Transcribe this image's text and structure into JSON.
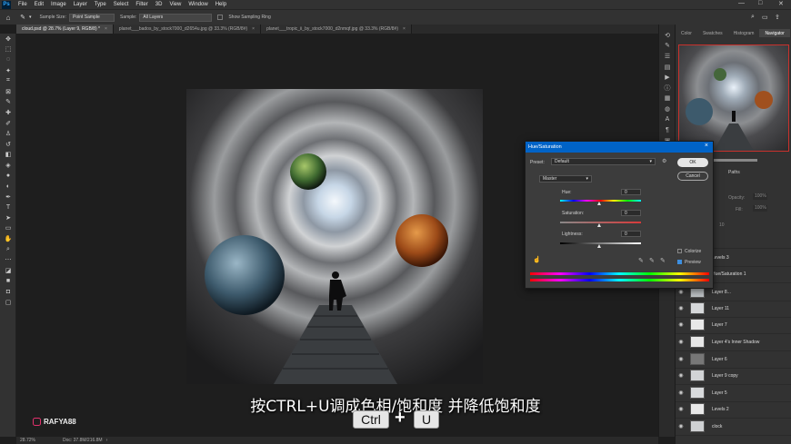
{
  "menubar": {
    "logo": "Ps",
    "items": [
      "File",
      "Edit",
      "Image",
      "Layer",
      "Type",
      "Select",
      "Filter",
      "3D",
      "View",
      "Window",
      "Help"
    ],
    "minimize": "—",
    "maximize": "□",
    "close": "✕"
  },
  "options": {
    "sample_size_label": "Sample Size:",
    "sample_size_value": "Point Sample",
    "sample_label": "Sample:",
    "sample_value": "All Layers",
    "show_ring_label": "Show Sampling Ring"
  },
  "tabs": [
    {
      "label": "cloud.psd @ 28.7% (Layer 9, RGB/8) *",
      "active": true
    },
    {
      "label": "planet___bados_by_stock7000_d2654u.jpg @ 33.3% (RGB/8#)",
      "active": false
    },
    {
      "label": "planet___tropic_ii_by_stock7000_d2nmqf.jpg @ 33.3% (RGB/8#)",
      "active": false
    }
  ],
  "status": {
    "zoom": "28.72%",
    "doc": "Doc: 37.8M/216.8M"
  },
  "panel": {
    "tabs": [
      "Color",
      "Swatches",
      "Histogram",
      "Navigator"
    ],
    "active_tab": "Navigator",
    "paths_label": "Paths",
    "opacity_label": "Opacity:",
    "opacity_value": "100%",
    "fill_label": "Fill:",
    "fill_value": "100%",
    "layer_group_label": "10"
  },
  "layers": [
    {
      "name": "",
      "thumb": "light"
    },
    {
      "name": "Levels 3",
      "thumb": "white"
    },
    {
      "name": "Hue/Saturation 1",
      "thumb": "white"
    },
    {
      "name": "Layer 8...",
      "thumb": "light"
    },
    {
      "name": "Layer 11",
      "thumb": "light"
    },
    {
      "name": "Layer 7",
      "thumb": "white"
    },
    {
      "name": "Layer 4's Inner Shadow",
      "thumb": "white"
    },
    {
      "name": "Layer 6",
      "thumb": "dark"
    },
    {
      "name": "Layer 9 copy",
      "thumb": "light"
    },
    {
      "name": "Layer 5",
      "thumb": "light"
    },
    {
      "name": "Levels 2",
      "thumb": "white"
    },
    {
      "name": "clock",
      "thumb": "light"
    }
  ],
  "dialog": {
    "title": "Hue/Saturation",
    "preset_label": "Preset:",
    "preset_value": "Default",
    "channel_value": "Master",
    "hue_label": "Hue:",
    "hue_value": "0",
    "saturation_label": "Saturation:",
    "saturation_value": "0",
    "lightness_label": "Lightness:",
    "lightness_value": "0",
    "ok_label": "OK",
    "cancel_label": "Cancel",
    "colorize_label": "Colorize",
    "colorize_checked": false,
    "preview_label": "Preview",
    "preview_checked": true
  },
  "overlay": {
    "subtitle": "按CTRL+U调成色相/饱和度 并降低饱和度",
    "key1": "Ctrl",
    "plus": "+",
    "key2": "U",
    "watermark": "RAFYA88"
  },
  "colors": {
    "accent_blue": "#0063c7",
    "navigator_frame": "#c9312c"
  }
}
